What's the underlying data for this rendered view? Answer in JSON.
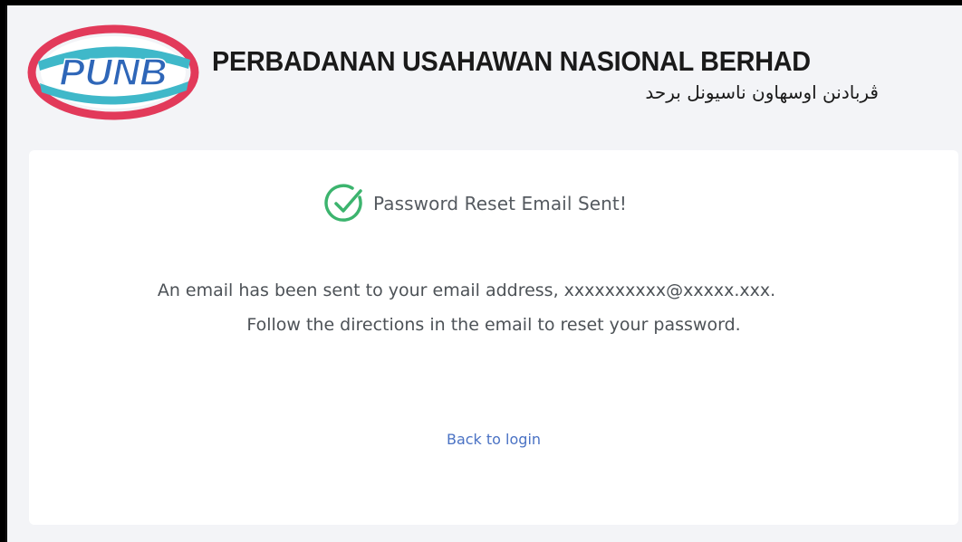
{
  "header": {
    "logo_text": "PUNB",
    "org_name": "PERBADANAN USAHAWAN NASIONAL BERHAD",
    "org_name_jawi": "ڤربادنن اوسهاون ناسيونل برحد"
  },
  "confirmation": {
    "title": "Password Reset Email Sent!",
    "icon": "check-circle-icon",
    "message_line1": "An email has been sent to your email address, xxxxxxxxxx@xxxxx.xxx.",
    "message_line2": "Follow the directions in the email to reset your password.",
    "back_link_label": "Back to login"
  },
  "colors": {
    "success": "#3cb46e",
    "link": "#4a72c4",
    "brand_red": "#e23a5a",
    "brand_teal": "#3fb8c9",
    "brand_blue": "#2e66b8"
  }
}
